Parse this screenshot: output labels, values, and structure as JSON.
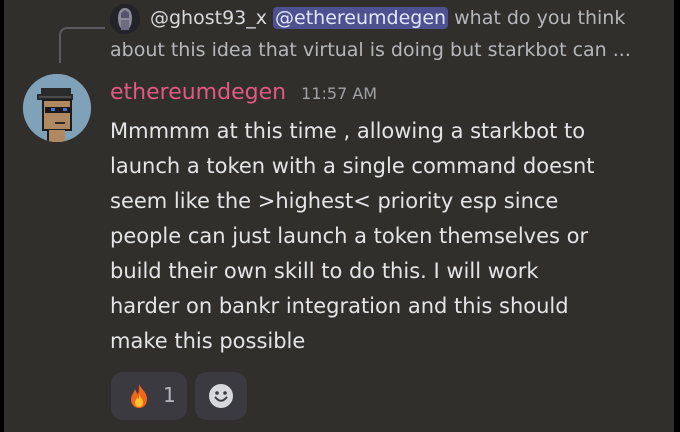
{
  "reply": {
    "username": "@ghost93_x",
    "mention": "@ethereumdegen",
    "preview_start": " what do you think",
    "preview_end": "about this idea that virtual is doing but starkbot can ..."
  },
  "message": {
    "author": "ethereumdegen",
    "timestamp": "11:57 AM",
    "author_color": "#e05a82",
    "lines": [
      "Mmmmm at this time , allowing a starkbot to",
      "launch a token with a single command doesnt",
      "seem like the >highest< priority esp since",
      "people can just launch a token themselves  or",
      "build their own skill to do this.  I will work",
      "harder on bankr integration and this should",
      "make this possible"
    ]
  },
  "reactions": [
    {
      "emoji": "fire-icon",
      "count": "1"
    }
  ],
  "add_reaction_icon": "smile-icon"
}
